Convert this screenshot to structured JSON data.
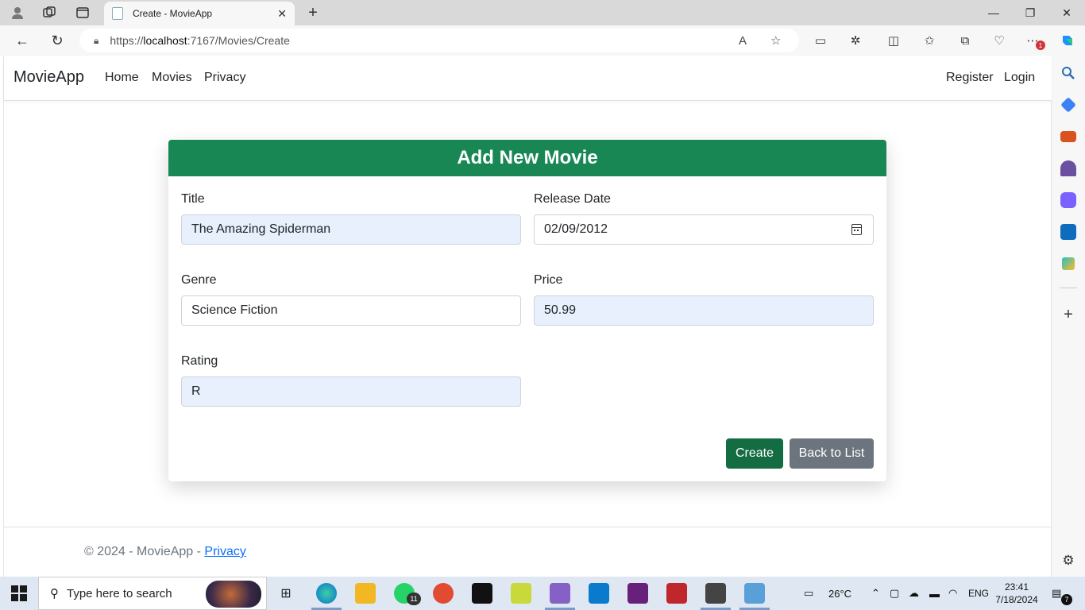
{
  "browser": {
    "tab_title": "Create - MovieApp",
    "tab_close": "✕",
    "new_tab": "+",
    "url_host": "https://",
    "url_domain": "localhost",
    "url_path": ":7167/Movies/Create",
    "notification_badge": "1"
  },
  "navbar": {
    "brand": "MovieApp",
    "links": [
      "Home",
      "Movies",
      "Privacy"
    ],
    "right_links": [
      "Register",
      "Login"
    ]
  },
  "form": {
    "header": "Add New Movie",
    "title_label": "Title",
    "title_value": "The Amazing Spiderman",
    "release_label": "Release Date",
    "release_value": "02/09/2012",
    "genre_label": "Genre",
    "genre_value": "Science Fiction",
    "price_label": "Price",
    "price_value": "50.99",
    "rating_label": "Rating",
    "rating_value": "R",
    "create_button": "Create",
    "back_button": "Back to List"
  },
  "footer": {
    "text": "© 2024 - MovieApp - ",
    "link": "Privacy"
  },
  "taskbar": {
    "search_placeholder": "Type here to search",
    "weather": "26°C",
    "language": "ENG",
    "time": "23:41",
    "date": "7/18/2024",
    "whatsapp_badge": "11",
    "notifications_count": "7"
  },
  "colors": {
    "header_green": "#198754",
    "create_button": "#146c43",
    "back_button": "#6c757d",
    "autofill_bg": "#e8f0fe"
  }
}
